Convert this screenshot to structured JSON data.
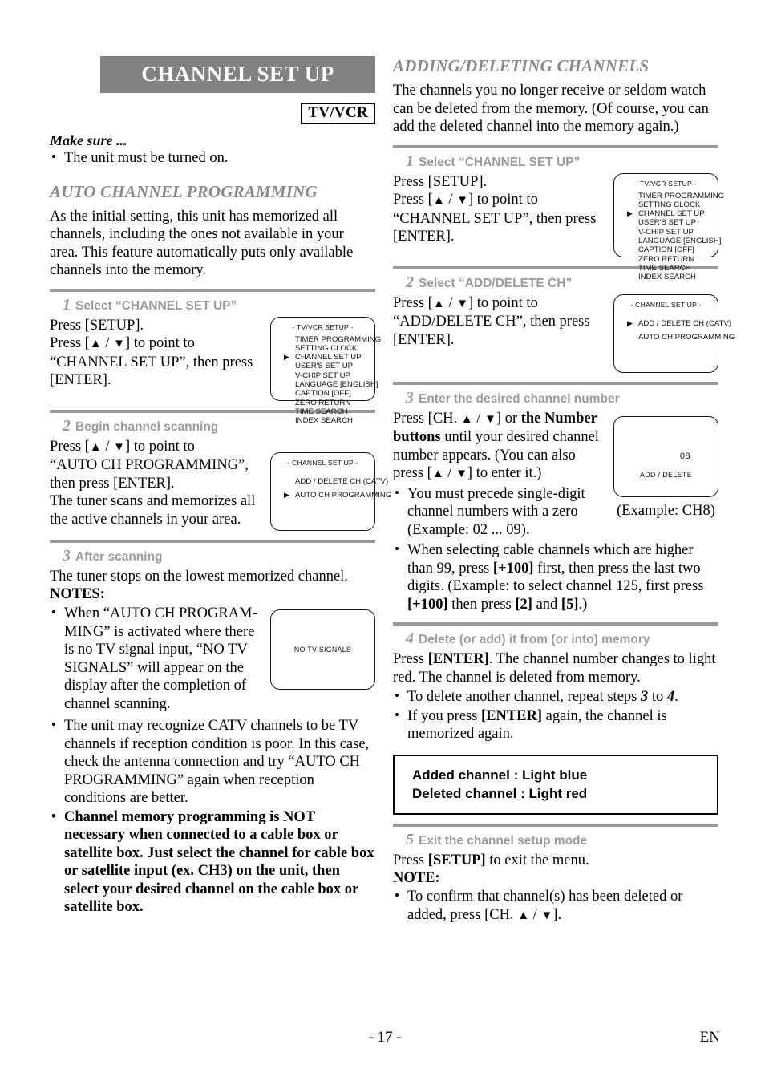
{
  "header": {
    "banner_title": "CHANNEL SET UP",
    "badge": "TV/VCR"
  },
  "left": {
    "make_sure_label": "Make sure ...",
    "make_sure_items": [
      "The unit must be turned on."
    ],
    "section_title": "AUTO CHANNEL PROGRAMMING",
    "intro": "As the initial setting, this unit has memorized all channels, including the ones not available in your area. This feature automatically puts only available channels into the memory.",
    "steps": [
      {
        "num": "1",
        "head": "Select “CHANNEL SET UP”",
        "line1": "Press [SETUP].",
        "line2_a": "Press [",
        "line2_b": "] to point to",
        "line3": "“CHANNEL SET UP”, then press",
        "line4": "[ENTER]."
      },
      {
        "num": "2",
        "head": "Begin channel scanning",
        "line1_a": "Press [",
        "line1_b": "] to point to",
        "line2": "“AUTO CH PROGRAMMING”,",
        "line3": "then press [ENTER].",
        "line4": "The tuner scans and memorizes all",
        "line5": "the active channels in your area."
      },
      {
        "num": "3",
        "head": "After scanning",
        "line1": "The tuner stops on the lowest memorized channel.",
        "notes_label": "NOTES:",
        "note1": "When “AUTO CH PROGRAM-MING” is activated where there is no TV signal input, “NO TV SIGNALS” will appear on the display after the completion of channel scanning.",
        "note2": "The unit may recognize CATV channels to be TV channels if reception condition is poor. In this case, check the antenna connection and try “AUTO CH PROGRAMMING” again when reception conditions are better.",
        "note3": "Channel memory programming is NOT necessary when connected to a cable box or satellite box. Just select the channel for cable box or satellite input (ex. CH3) on the unit, then select your desired channel on the cable box or satellite box."
      }
    ]
  },
  "right": {
    "section_title": "ADDING/DELETING CHANNELS",
    "intro": "The channels you no longer receive or seldom watch can be deleted from the memory. (Of course, you can add the deleted channel into the memory again.)",
    "steps": [
      {
        "num": "1",
        "head": "Select “CHANNEL SET UP”",
        "line1": "Press [SETUP].",
        "line2_a": "Press [",
        "line2_b": "] to point to",
        "line3": "“CHANNEL SET UP”, then press",
        "line4": "[ENTER]."
      },
      {
        "num": "2",
        "head": "Select “ADD/DELETE CH”",
        "line1_a": "Press [",
        "line1_b": "] to point to",
        "line2": "“ADD/DELETE CH”, then press",
        "line3": "[ENTER]."
      },
      {
        "num": "3",
        "head": "Enter the desired channel number",
        "p1_a": "Press [CH. ",
        "p1_b": "] or ",
        "p1_bold": "the Number buttons",
        "p1_c": " until your desired channel number appears. (You can also press [",
        "p1_d": "] to enter it.)",
        "note1": "You must precede single-digit channel numbers with a zero (Example: 02 ...  09).",
        "note2_a": "When selecting cable channels which are higher than 99, press ",
        "note2_b": "[+100]",
        "note2_c": " first, then press the last two digits. (Example: to select channel 125, first press ",
        "note2_d": "[+100]",
        "note2_e": " then press ",
        "note2_f": "[2]",
        "note2_g": " and ",
        "note2_h": "[5]",
        "note2_i": ".)",
        "caption": "(Example: CH8)"
      },
      {
        "num": "4",
        "head": "Delete (or add) it from (or into) memory",
        "line1_a": "Press ",
        "line1_b": "[ENTER]",
        "line1_c": ". The channel number changes to light red. The channel is deleted from memory.",
        "note1_a": "To delete another channel, repeat steps ",
        "note1_b": "3",
        "note1_c": " to ",
        "note1_d": "4",
        "note1_e": ".",
        "note2_a": "If you press ",
        "note2_b": "[ENTER]",
        "note2_c": " again, the channel is memorized again."
      },
      {
        "num": "5",
        "head": "Exit the channel setup mode",
        "line1_a": "Press ",
        "line1_b": "[SETUP]",
        "line1_c": " to exit the menu.",
        "note_label": "NOTE:",
        "note1_a": "To confirm that channel(s) has been deleted or added, press [CH. ",
        "note1_b": "]."
      }
    ],
    "emphasis_box": {
      "line1": "Added channel   : Light blue",
      "line2": "Deleted channel : Light red"
    }
  },
  "osd_screens": {
    "tv_vcr_setup": {
      "title": "- TV/VCR SETUP -",
      "items": [
        {
          "label": "TIMER PROGRAMMING",
          "selected": false
        },
        {
          "label": "SETTING CLOCK",
          "selected": false
        },
        {
          "label": "CHANNEL SET UP",
          "selected": true
        },
        {
          "label": "USER'S SET UP",
          "selected": false
        },
        {
          "label": "V-CHIP SET UP",
          "selected": false
        },
        {
          "label": "LANGUAGE  [ENGLISH]",
          "selected": false
        },
        {
          "label": "CAPTION  [OFF]",
          "selected": false
        },
        {
          "label": "ZERO RETURN",
          "selected": false
        },
        {
          "label": "TIME SEARCH",
          "selected": false
        },
        {
          "label": "INDEX SEARCH",
          "selected": false
        }
      ]
    },
    "channel_set_up_auto": {
      "title": "- CHANNEL SET UP -",
      "items": [
        {
          "label": "ADD / DELETE CH (CATV)",
          "selected": false
        },
        {
          "label": "AUTO CH PROGRAMMING",
          "selected": true
        }
      ]
    },
    "channel_set_up_add": {
      "title": "- CHANNEL SET UP -",
      "items": [
        {
          "label": "ADD / DELETE CH (CATV)",
          "selected": true
        },
        {
          "label": "AUTO CH PROGRAMMING",
          "selected": false
        }
      ]
    },
    "no_tv_signals": {
      "message": "NO TV SIGNALS"
    },
    "add_delete_screen": {
      "channel_number": "08",
      "label": "ADD / DELETE"
    },
    "selection_arrow": "▶"
  },
  "footer": {
    "page_number": "- 17 -",
    "language_code": "EN"
  }
}
